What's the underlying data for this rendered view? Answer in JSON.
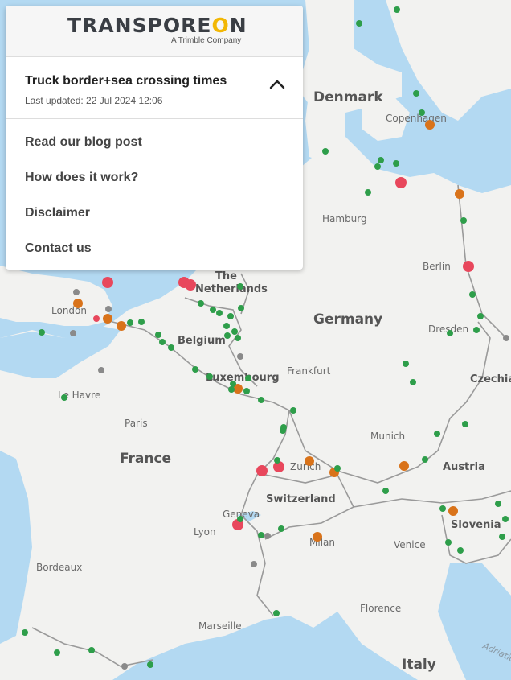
{
  "panel": {
    "brand": {
      "pre": "TRANSPORE",
      "mark": "O",
      "post": "N",
      "tagline": "A Trimble Company"
    },
    "title": "Truck border+sea crossing times",
    "updated": "Last updated: 22 Jul 2024 12:06",
    "menu": [
      {
        "label": "Read our blog post"
      },
      {
        "label": "How does it work?"
      },
      {
        "label": "Disclaimer"
      },
      {
        "label": "Contact us"
      }
    ]
  },
  "map": {
    "countries": [
      "Denmark",
      "The",
      "Netherlands",
      "Germany",
      "Belgium",
      "Luxembourg",
      "Czechia",
      "France",
      "Switzerland",
      "Austria",
      "Slovenia",
      "Italy"
    ],
    "cities": [
      "Copenhagen",
      "Hamburg",
      "Berlin",
      "London",
      "Dresden",
      "Frankfurt",
      "Le Havre",
      "Paris",
      "Munich",
      "Zurich",
      "Geneva",
      "Lyon",
      "Milan",
      "Venice",
      "Bordeaux",
      "Florence",
      "Marseille"
    ],
    "seas": [
      "Adriatic"
    ],
    "colors": {
      "land": "#f2f2f0",
      "water": "#b3d9f2",
      "border": "#9a9a9a",
      "green": "#2e9e4a",
      "orange": "#d9731a",
      "red": "#e8475c",
      "gray": "#8a8a8a"
    }
  }
}
